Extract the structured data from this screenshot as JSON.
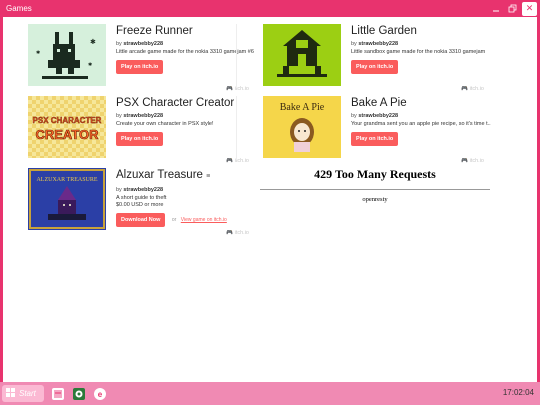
{
  "window": {
    "title": "Games",
    "min_icon": "minimize-icon",
    "max_icon": "maximize-icon",
    "close_icon": "close-icon"
  },
  "games": [
    {
      "title": "Freeze Runner",
      "by": "by",
      "author": "strawbebby228",
      "desc": "Little arcade game made for the nokia 3310 gamejam #6",
      "button": "Play on itch.io",
      "badge": "itch.io"
    },
    {
      "title": "Little Garden",
      "by": "by",
      "author": "strawbebby228",
      "desc": "Little sandbox game made for the nokia 3310 gamejam",
      "button": "Play on itch.io",
      "badge": "itch.io"
    },
    {
      "title": "PSX Character Creator",
      "by": "by",
      "author": "strawbebby228",
      "desc": "Create your own character in PSX style!",
      "button": "Play on itch.io",
      "badge": "itch.io",
      "thumb_line1": "PSX CHARACTER",
      "thumb_line2": "CREATOR"
    },
    {
      "title": "Bake A Pie",
      "by": "by",
      "author": "strawbebby228",
      "desc": "Your grandma sent you an apple pie recipe, so it's time t...",
      "button": "Play on itch.io",
      "badge": "itch.io",
      "thumb_text": "Bake A Pie"
    },
    {
      "title": "Alzuxar Treasure",
      "by": "by",
      "author": "strawbebby228",
      "desc": "A short guide to theft",
      "price": "$0.00 USD or more",
      "button": "Download Now",
      "or": "or",
      "link": "View game on itch.io",
      "badge": "itch.io",
      "thumb_text": "ALZUXAR TREASURE"
    }
  ],
  "error": {
    "heading": "429 Too Many Requests",
    "server": "openresty"
  },
  "taskbar": {
    "start": "Start",
    "clock": "17:02:04"
  },
  "colors": {
    "accent": "#e8336e",
    "button": "#fa5c5c",
    "taskbar": "#f08ab3"
  }
}
